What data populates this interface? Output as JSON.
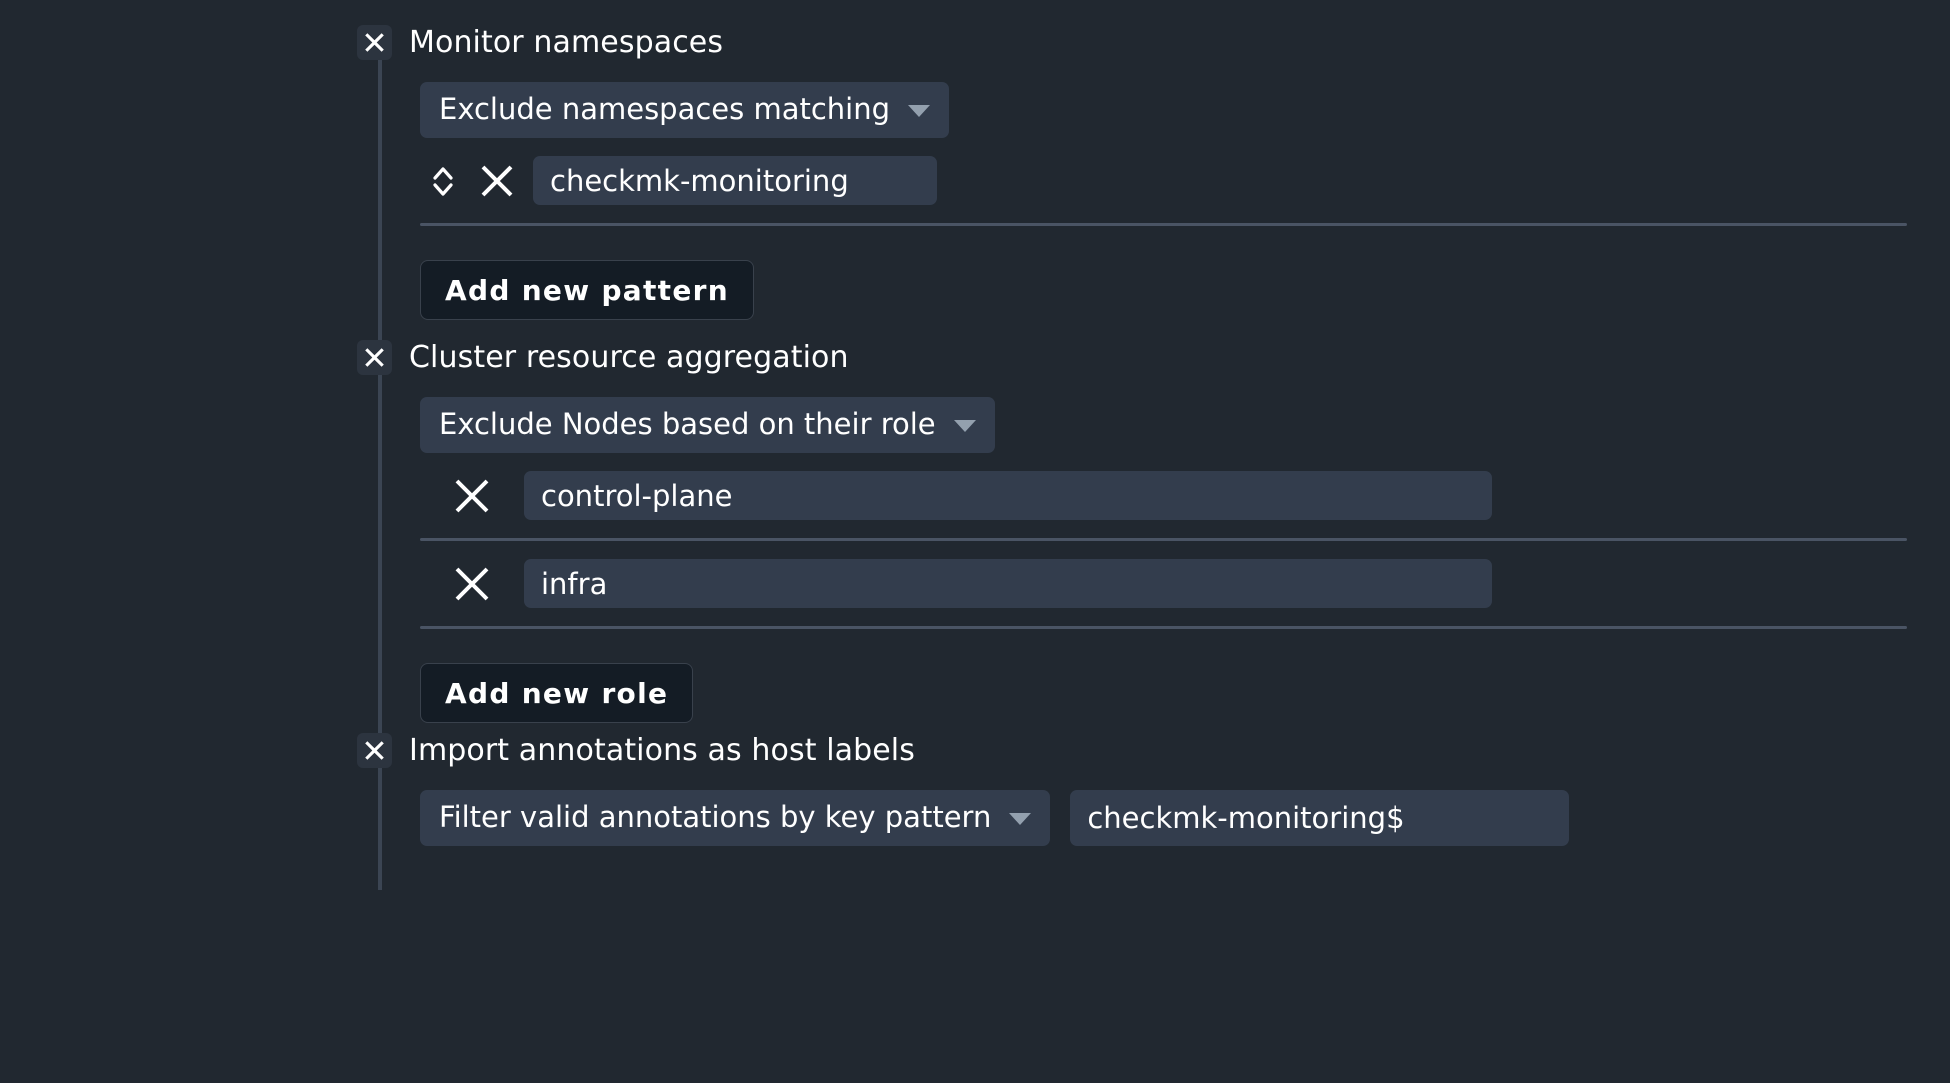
{
  "theme": {
    "page_bg": "#212830",
    "field_bg": "#333d4d",
    "checkbox_bg": "#2c343f",
    "button_bg": "#141c25",
    "rail_color": "#3b4553",
    "separator_color": "#4a5464",
    "caret_color": "#93a0ae",
    "text_color": "#ffffff"
  },
  "sections": [
    {
      "id": "monitor-namespaces",
      "checkbox_state": "checked",
      "checkbox_icon": "cross-icon",
      "title": "Monitor namespaces",
      "dropdown": {
        "label": "Exclude namespaces matching",
        "icon": "chevron-down-icon"
      },
      "rows": [
        {
          "sorter_icon": "sort-updown-icon",
          "delete_icon": "close-icon",
          "value": "checkmk-monitoring"
        }
      ],
      "add_button": "Add new pattern"
    },
    {
      "id": "cluster-resource-aggregation",
      "checkbox_state": "checked",
      "checkbox_icon": "cross-icon",
      "title": "Cluster resource aggregation",
      "dropdown": {
        "label": "Exclude Nodes based on their role",
        "icon": "chevron-down-icon"
      },
      "rows": [
        {
          "delete_icon": "close-icon",
          "value": "control-plane"
        },
        {
          "delete_icon": "close-icon",
          "value": "infra"
        }
      ],
      "add_button": "Add new role"
    },
    {
      "id": "import-annotations-as-host-labels",
      "checkbox_state": "checked",
      "checkbox_icon": "cross-icon",
      "title": "Import annotations as host labels",
      "dropdown": {
        "label": "Filter valid annotations by key pattern",
        "icon": "chevron-down-icon"
      },
      "pattern_value": "checkmk-monitoring$"
    }
  ]
}
